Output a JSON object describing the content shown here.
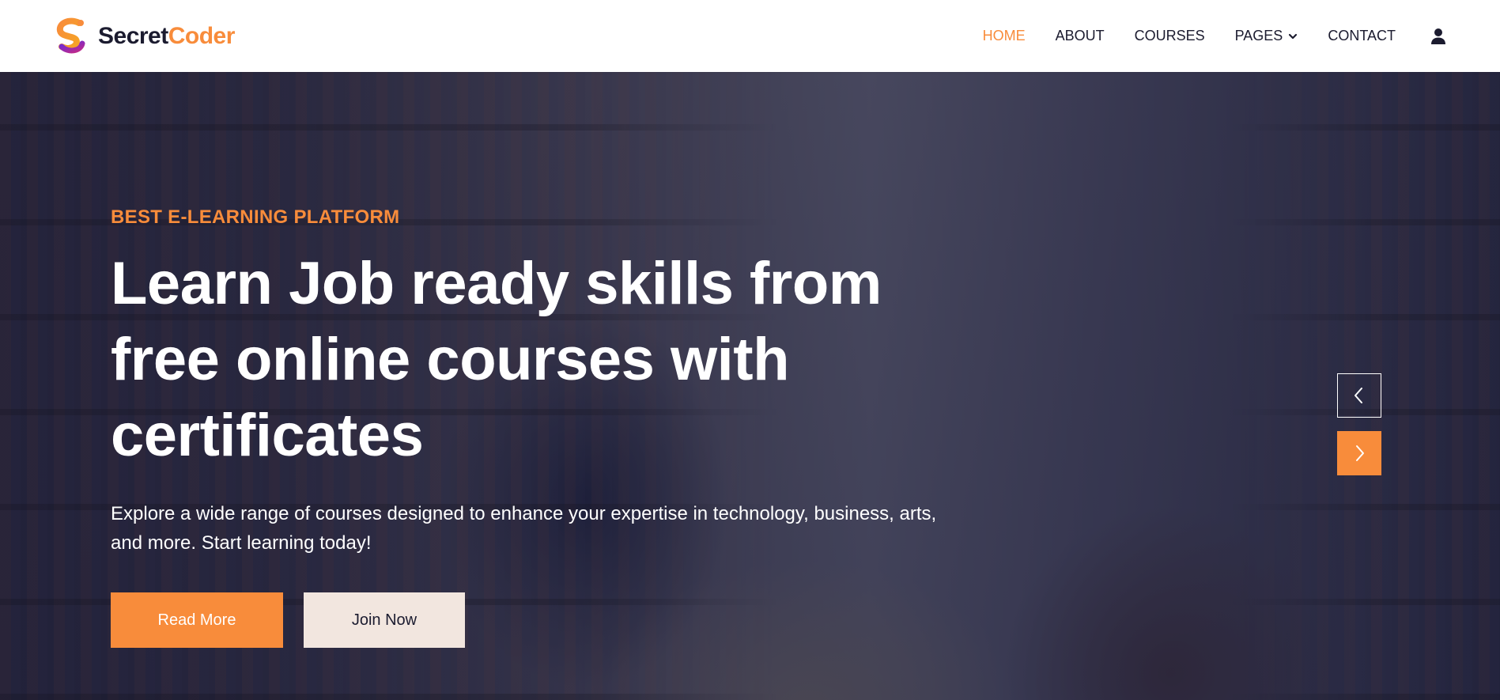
{
  "brand": {
    "name_part1": "Secret",
    "name_part2": "Coder",
    "icon": "s-logo-icon"
  },
  "nav": {
    "items": [
      {
        "label": "HOME",
        "active": true
      },
      {
        "label": "ABOUT",
        "active": false
      },
      {
        "label": "COURSES",
        "active": false
      },
      {
        "label": "PAGES",
        "active": false,
        "has_dropdown": true
      },
      {
        "label": "CONTACT",
        "active": false
      }
    ],
    "user_icon": "user-icon"
  },
  "hero": {
    "eyebrow": "BEST E-LEARNING PLATFORM",
    "title": "Learn Job ready skills from free online courses with certificates",
    "description": "Explore a wide range of courses designed to enhance your expertise in technology, business, arts, and more. Start learning today!",
    "primary_button": "Read More",
    "secondary_button": "Join Now",
    "prev_icon": "chevron-left-icon",
    "next_icon": "chevron-right-icon"
  },
  "colors": {
    "accent": "#f88c3b",
    "dark": "#1b1b2f",
    "light_button": "#f2e6df",
    "white": "#ffffff"
  }
}
